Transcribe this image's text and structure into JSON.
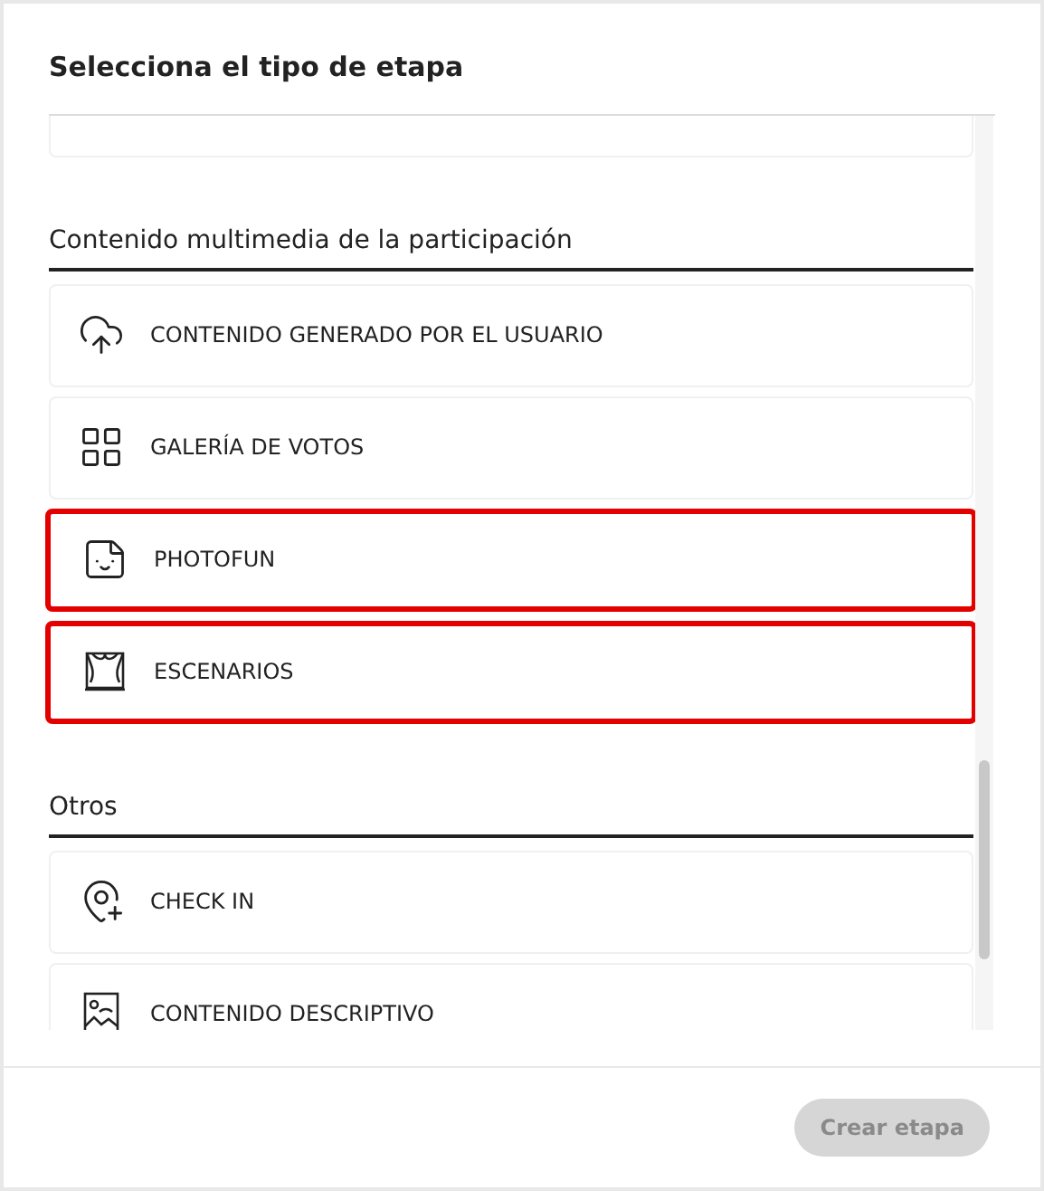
{
  "dialog": {
    "title": "Selecciona el tipo de etapa"
  },
  "sections": [
    {
      "heading": "Contenido multimedia de la participación",
      "items": [
        {
          "label": "CONTENIDO GENERADO POR EL USUARIO",
          "kind": "upload",
          "highlighted": false
        },
        {
          "label": "GALERÍA DE VOTOS",
          "kind": "gallery",
          "highlighted": false
        },
        {
          "label": "PHOTOFUN",
          "kind": "sticker",
          "highlighted": true
        },
        {
          "label": "ESCENARIOS",
          "kind": "stage",
          "highlighted": true
        }
      ]
    },
    {
      "heading": "Otros",
      "items": [
        {
          "label": "CHECK IN",
          "kind": "checkin",
          "highlighted": false
        },
        {
          "label": "CONTENIDO DESCRIPTIVO",
          "kind": "description",
          "highlighted": false
        }
      ]
    }
  ],
  "footer": {
    "button": "Crear etapa",
    "disabled": true
  }
}
